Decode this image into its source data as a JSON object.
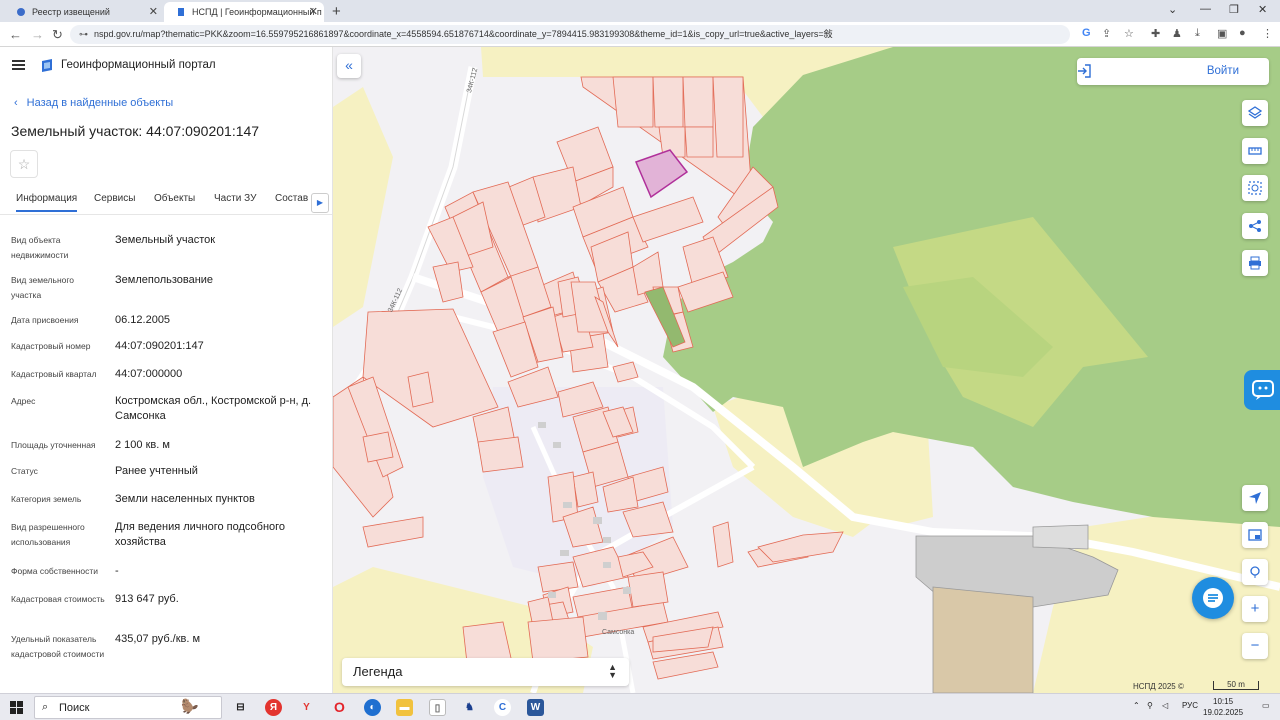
{
  "browser": {
    "tabs": [
      {
        "title": "Реестр извещений",
        "active": false
      },
      {
        "title": "НСПД | Геоинформационный п",
        "active": true
      }
    ],
    "url": "nspd.gov.ru/map?thematic=PKK&zoom=16.559795216861897&coordinate_x=4558594.651876714&coordinate_y=7894415.983199308&theme_id=1&is_copy_url=true&active_layers=敍"
  },
  "header": {
    "portal_title": "Геоинформационный портал"
  },
  "panel": {
    "back_label": "Назад в найденные объекты",
    "title": "Земельный участок: 44:07:090201:147",
    "tabs": [
      "Информация",
      "Сервисы",
      "Объекты",
      "Части ЗУ",
      "Состав"
    ],
    "fields": [
      {
        "label": "Вид объекта недвижимости",
        "value": "Земельный участок"
      },
      {
        "label": "Вид земельного участка",
        "value": "Землепользование"
      },
      {
        "label": "Дата присвоения",
        "value": "06.12.2005"
      },
      {
        "label": "Кадастровый номер",
        "value": "44:07:090201:147"
      },
      {
        "label": "Кадастровый квартал",
        "value": "44:07:000000"
      },
      {
        "label": "Адрес",
        "value": "Костромская обл., Костромской р-н, д. Самсонка"
      },
      {
        "label": "Площадь уточненная",
        "value": "2 100 кв. м"
      },
      {
        "label": "Статус",
        "value": "Ранее учтенный"
      },
      {
        "label": "Категория земель",
        "value": "Земли населенных пунктов"
      },
      {
        "label": "Вид разрешенного использования",
        "value": "Для ведения личного подсобного хозяйства"
      },
      {
        "label": "Форма собственности",
        "value": "-"
      },
      {
        "label": "Кадастровая стоимость",
        "value": "913 647 руб."
      },
      {
        "label": "Удельный показатель кадастровой стоимости",
        "value": "435,07 руб./кв. м"
      }
    ]
  },
  "map": {
    "login_label": "Войти",
    "legend_label": "Легенда",
    "copyright": "НСПД 2025 ©",
    "scale": "50 m",
    "labels": {
      "road1": "34К-112",
      "road2": "34К-112",
      "village": "Самсонка"
    },
    "colors": {
      "parcel_stroke": "#e26a55",
      "parcel_fill": "#f7ddd8",
      "forest": "#a6cc87",
      "field": "#f6f1c2",
      "selected": "#b0309a",
      "accent": "#2f6fd6"
    }
  },
  "taskbar": {
    "search_label": "Поиск",
    "language": "РУС",
    "time": "10:15",
    "date": "19.02.2025"
  }
}
